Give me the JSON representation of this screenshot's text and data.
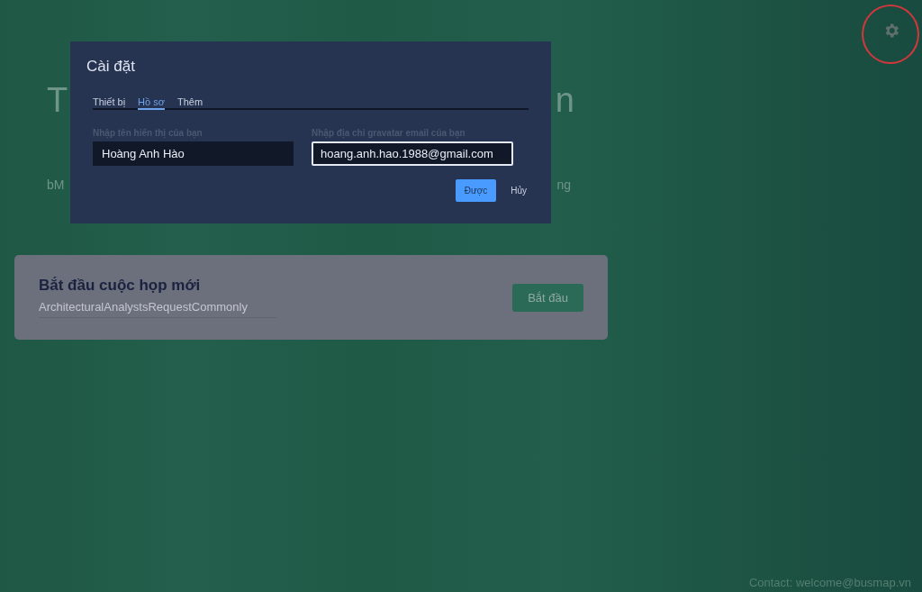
{
  "hero": {
    "title_left": "T",
    "title_right": "n",
    "subtitle_left": "bM",
    "subtitle_right": "ng"
  },
  "settings_dialog": {
    "title": "Cài đặt",
    "tabs": [
      {
        "label": "Thiết bị",
        "selected": false
      },
      {
        "label": "Hồ sơ",
        "selected": true
      },
      {
        "label": "Thêm",
        "selected": false
      }
    ],
    "fields": [
      {
        "label": "Nhập tên hiển thị của bạn",
        "value": "Hoàng Anh Hào",
        "focused": false
      },
      {
        "label": "Nhập địa chỉ gravatar email của bạn",
        "value": "hoang.anh.hao.1988@gmail.com",
        "focused": true
      }
    ],
    "buttons": [
      {
        "label": "Được",
        "kind": "primary"
      },
      {
        "label": "Hủy",
        "kind": "text"
      }
    ]
  },
  "start_card": {
    "title": "Bắt đầu cuộc họp mới",
    "room_name": "ArchitecturalAnalystsRequestCommonly",
    "button": "Bắt đầu"
  },
  "settings_highlighted": true,
  "footer": {
    "contact": "Contact: welcome@busmap.vn"
  }
}
